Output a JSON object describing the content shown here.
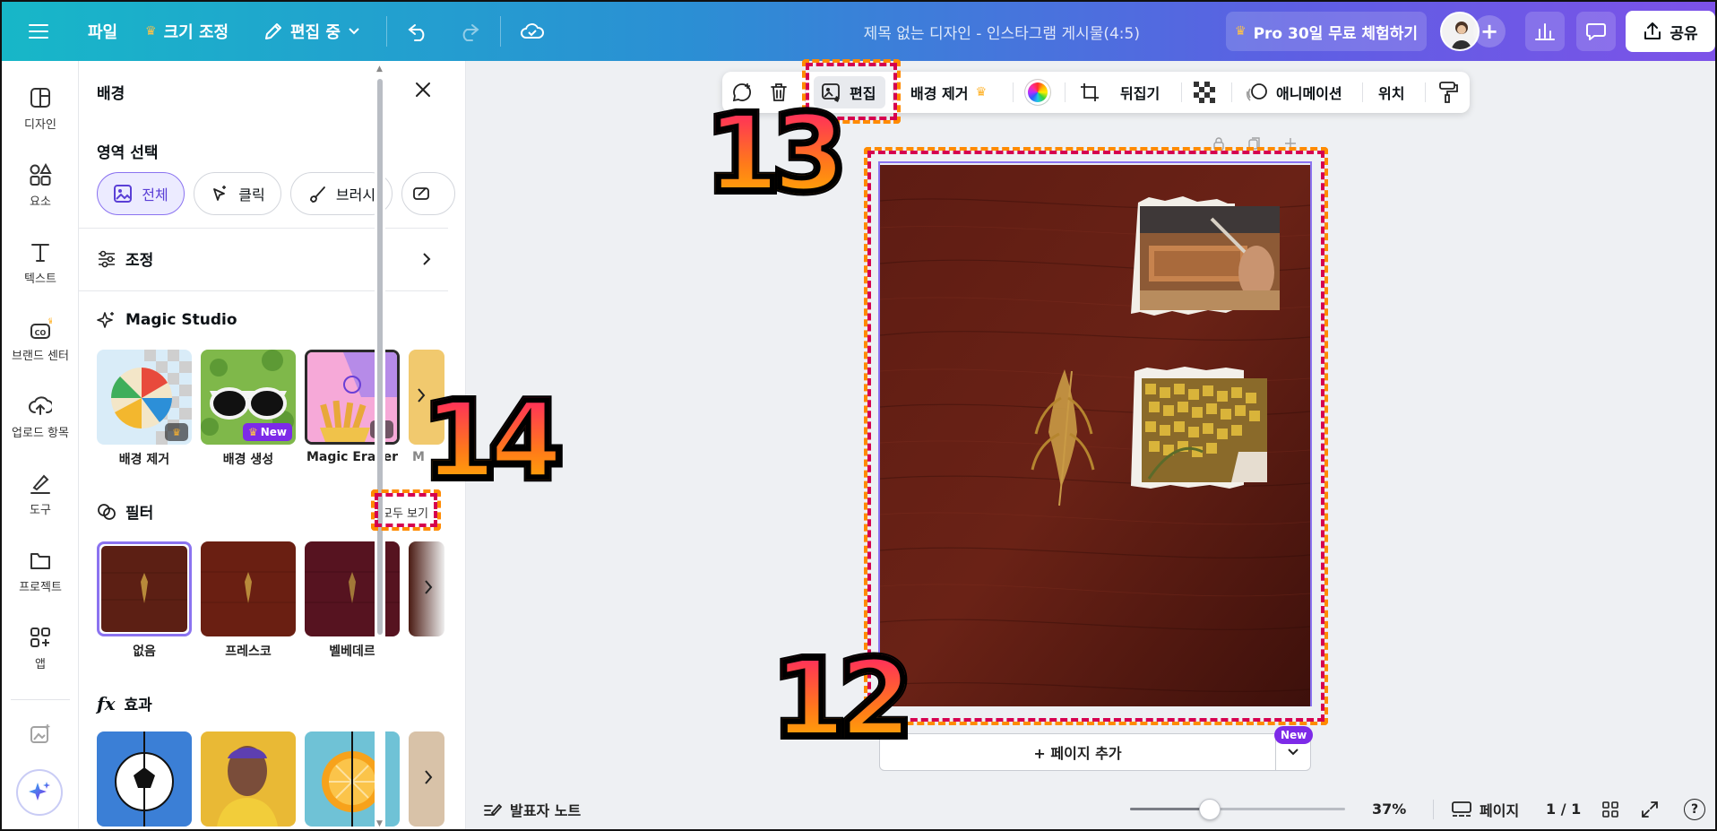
{
  "topbar": {
    "menu_icon": "hamburger-icon",
    "file": "파일",
    "resize": "크기 조정",
    "editing": "편집 중",
    "doc_title": "제목 없는 디자인 - 인스타그램 게시물(4:5)",
    "pro_trial": "Pro 30일 무료 체험하기",
    "share": "공유"
  },
  "rail": {
    "items": [
      {
        "label": "디자인",
        "icon": "design-icon"
      },
      {
        "label": "요소",
        "icon": "elements-icon"
      },
      {
        "label": "텍스트",
        "icon": "text-icon"
      },
      {
        "label": "브랜드 센터",
        "icon": "brand-icon"
      },
      {
        "label": "업로드 항목",
        "icon": "upload-icon"
      },
      {
        "label": "도구",
        "icon": "draw-icon"
      },
      {
        "label": "프로젝트",
        "icon": "folder-icon"
      },
      {
        "label": "앱",
        "icon": "apps-icon"
      }
    ]
  },
  "panel": {
    "title": "배경",
    "area_select": "영역 선택",
    "chips": [
      "전체",
      "클릭",
      "브러시"
    ],
    "adjust": "조정",
    "magic_studio": "Magic Studio",
    "magic_items": [
      "배경 제거",
      "배경 생성",
      "Magic Eraser",
      "M"
    ],
    "new_badge": "New",
    "filter": "필터",
    "see_all": "모두 보기",
    "filters": [
      "없음",
      "프레스코",
      "벨베데르"
    ],
    "effects": "효과"
  },
  "floatbar": {
    "edit": "편집",
    "remove_bg": "배경 제거",
    "flip": "뒤집기",
    "animate": "애니메이션",
    "position": "위치"
  },
  "canvas": {
    "add_page": "+ 페이지 추가",
    "new_tag": "New"
  },
  "bottombar": {
    "notes": "발표자 노트",
    "zoom": "37%",
    "zoom_level": 0.37,
    "pages": "페이지",
    "page_count": "1 / 1",
    "help": "?"
  },
  "annotations": [
    "12",
    "13",
    "14"
  ],
  "colors": {
    "accent": "#7d2ae8",
    "annotation_orange": "#ff8a00",
    "annotation_pink": "#d6004f",
    "wood": "#5a1b12"
  }
}
